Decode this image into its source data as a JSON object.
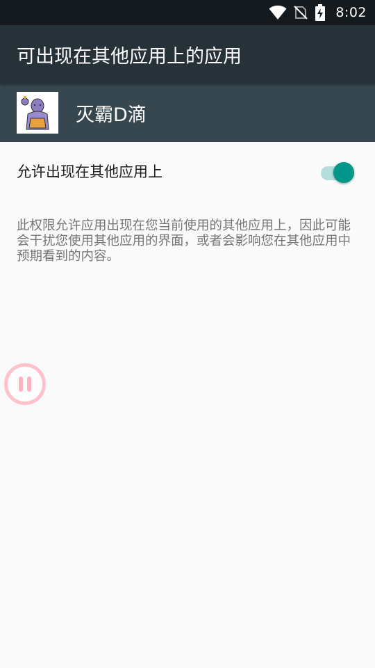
{
  "status_bar": {
    "time": "8:02",
    "icons": [
      "wifi-icon",
      "no-sim-icon",
      "battery-charging-icon"
    ]
  },
  "app_bar": {
    "title": "可出现在其他应用上的应用"
  },
  "app_header": {
    "name": "灭霸D滴",
    "icon": "app-icon"
  },
  "permission": {
    "toggle_label": "允许出现在其他应用上",
    "toggle_state": "on",
    "description": "此权限允许应用出现在您当前使用的其他应用上，因此可能会干扰您使用其他应用的界面，或者会影响您在其他应用中预期看到的内容。"
  },
  "floating_button": {
    "icon": "pause-icon"
  },
  "colors": {
    "status_bar": "#141a1d",
    "app_bar": "#263238",
    "app_header": "#37474f",
    "accent": "#009688",
    "accent_light": "#b2dfdb",
    "floating_button": "#ffb3c1"
  }
}
